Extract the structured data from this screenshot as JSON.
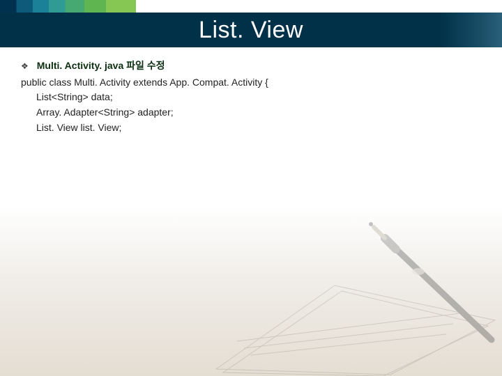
{
  "slide": {
    "title": "List. View",
    "bullet": {
      "icon": "❖",
      "text": "Multi. Activity. java 파일 수정"
    },
    "code_lines": [
      "public class Multi. Activity extends App. Compat. Activity {",
      "List<String> data;",
      "Array. Adapter<String> adapter;",
      "List. View list. View;"
    ]
  }
}
